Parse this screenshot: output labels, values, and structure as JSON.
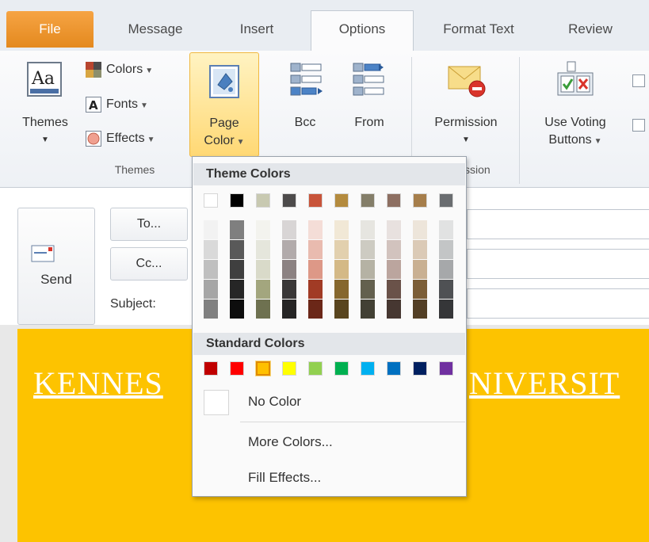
{
  "tabs": [
    {
      "label": "File"
    },
    {
      "label": "Message"
    },
    {
      "label": "Insert"
    },
    {
      "label": "Options"
    },
    {
      "label": "Format Text"
    },
    {
      "label": "Review"
    }
  ],
  "ribbon": {
    "themes_group": {
      "themes_button": "Themes",
      "colors": "Colors",
      "fonts": "Fonts",
      "effects": "Effects",
      "group_label": "Themes"
    },
    "page_color": {
      "line1": "Page",
      "line2": "Color"
    },
    "bcc": "Bcc",
    "from": "From",
    "permission": "Permission",
    "permission_group_label": "ssion",
    "voting": {
      "line1": "Use Voting",
      "line2": "Buttons"
    }
  },
  "compose": {
    "send": "Send",
    "to": "To...",
    "cc": "Cc...",
    "subject": "Subject:"
  },
  "body": {
    "banner_left": "KENNES",
    "banner_right": "NIVERSIT"
  },
  "page_color_menu": {
    "theme_colors_header": "Theme Colors",
    "standard_colors_header": "Standard Colors",
    "no_color": "No Color",
    "more_colors": "More Colors...",
    "fill_effects": "Fill Effects...",
    "theme_top_row": [
      "#ffffff",
      "#000000",
      "#c8c9b1",
      "#4d4b4b",
      "#c8543a",
      "#b48b3e",
      "#847e69",
      "#8d6f62",
      "#a67e4b",
      "#6a6d70"
    ],
    "theme_shades": [
      [
        "#f2f2f2",
        "#d9d9d9",
        "#bfbfbf",
        "#a6a6a6",
        "#808080"
      ],
      [
        "#7f7f7f",
        "#595959",
        "#3f3f3f",
        "#262626",
        "#0d0d0d"
      ],
      [
        "#f3f3ee",
        "#e5e6dc",
        "#d9dac9",
        "#a3a67e",
        "#6e7150"
      ],
      [
        "#d8d5d5",
        "#b2abab",
        "#8c8282",
        "#3a3838",
        "#262525"
      ],
      [
        "#f4ddd7",
        "#e9bbaf",
        "#dd9887",
        "#a13b25",
        "#6b2718"
      ],
      [
        "#f1e8d6",
        "#e2d0ae",
        "#d4b986",
        "#86672d",
        "#59451e"
      ],
      [
        "#e6e5e0",
        "#cdcbc2",
        "#b5b2a4",
        "#63604e",
        "#424034"
      ],
      [
        "#e8e1df",
        "#d2c3be",
        "#bba59e",
        "#6a5249",
        "#463731"
      ],
      [
        "#ede5da",
        "#dbcab6",
        "#c9b092",
        "#7c5e37",
        "#533f25"
      ],
      [
        "#e1e2e2",
        "#c3c5c6",
        "#a6a8aa",
        "#4f5154",
        "#353638"
      ]
    ],
    "standard_colors": [
      "#c00000",
      "#ff0000",
      "#ffc000",
      "#ffff00",
      "#92d050",
      "#00b050",
      "#00b0f0",
      "#0070c0",
      "#002060",
      "#7030a0"
    ],
    "selected_standard_index": 2
  },
  "colors": {
    "page_fill": "#fdc300",
    "file_tab": "#f0962d",
    "highlight": "#ffd874"
  }
}
